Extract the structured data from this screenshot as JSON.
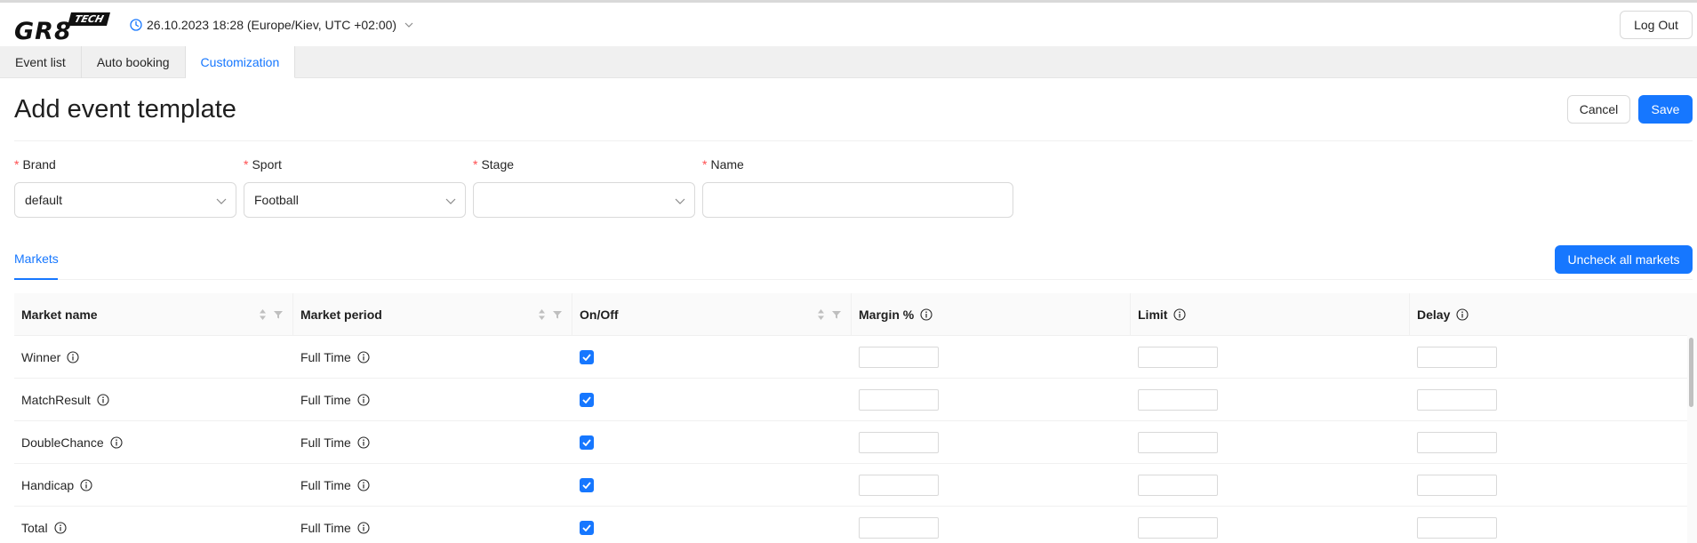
{
  "header": {
    "logo_main": "GR8",
    "logo_tag": "TECH",
    "datetime": "26.10.2023 18:28 (Europe/Kiev, UTC +02:00)",
    "logout_label": "Log Out"
  },
  "tabs": [
    {
      "label": "Event list",
      "active": false
    },
    {
      "label": "Auto booking",
      "active": false
    },
    {
      "label": "Customization",
      "active": true
    }
  ],
  "page": {
    "title": "Add event template",
    "cancel_label": "Cancel",
    "save_label": "Save"
  },
  "form": {
    "required_mark": "*",
    "brand": {
      "label": "Brand",
      "value": "default"
    },
    "sport": {
      "label": "Sport",
      "value": "Football"
    },
    "stage": {
      "label": "Stage",
      "value": ""
    },
    "name": {
      "label": "Name",
      "value": ""
    }
  },
  "markets": {
    "tab_label": "Markets",
    "uncheck_all_label": "Uncheck all markets",
    "columns": {
      "market_name": "Market name",
      "market_period": "Market period",
      "on_off": "On/Off",
      "margin": "Margin %",
      "limit": "Limit",
      "delay": "Delay"
    },
    "rows": [
      {
        "name": "Winner",
        "period": "Full Time",
        "on": true,
        "margin": "",
        "limit": "",
        "delay": ""
      },
      {
        "name": "MatchResult",
        "period": "Full Time",
        "on": true,
        "margin": "",
        "limit": "",
        "delay": ""
      },
      {
        "name": "DoubleChance",
        "period": "Full Time",
        "on": true,
        "margin": "",
        "limit": "",
        "delay": ""
      },
      {
        "name": "Handicap",
        "period": "Full Time",
        "on": true,
        "margin": "",
        "limit": "",
        "delay": ""
      },
      {
        "name": "Total",
        "period": "Full Time",
        "on": true,
        "margin": "",
        "limit": "",
        "delay": ""
      }
    ]
  },
  "colors": {
    "accent": "#1677ff",
    "required": "#ff4d4f",
    "tab_bar_bg": "#f0f0f0",
    "table_header_bg": "#fafafa"
  }
}
